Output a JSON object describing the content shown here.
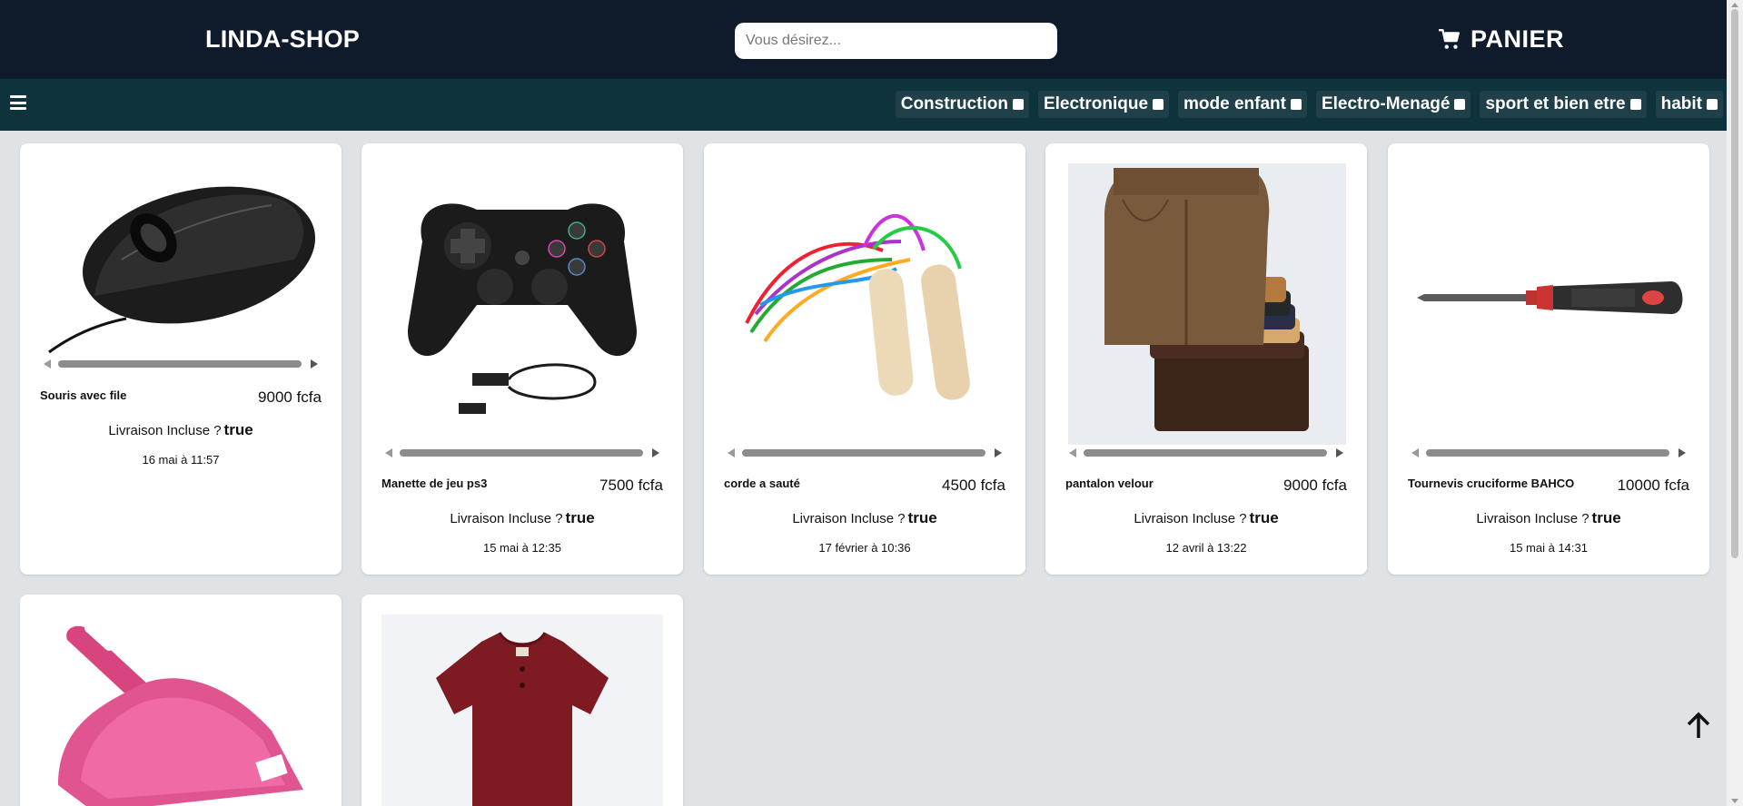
{
  "header": {
    "brand": "LINDA-SHOP",
    "search_placeholder": "Vous désirez...",
    "cart_label": "PANIER"
  },
  "categories": [
    {
      "label": "Construction"
    },
    {
      "label": "Electronique"
    },
    {
      "label": "mode enfant"
    },
    {
      "label": "Electro-Menagé"
    },
    {
      "label": "sport et bien etre"
    },
    {
      "label": "habit"
    }
  ],
  "delivery_label": "Livraison Incluse ?",
  "products": [
    {
      "name": "Souris avec file",
      "price": "9000 fcfa",
      "delivery": "true",
      "date": "16 mai à 11:57",
      "image": "mouse-image"
    },
    {
      "name": "Manette de jeu ps3",
      "price": "7500 fcfa",
      "delivery": "true",
      "date": "15 mai à 12:35",
      "image": "gamepad-image"
    },
    {
      "name": "corde a sauté",
      "price": "4500 fcfa",
      "delivery": "true",
      "date": "17 février à 10:36",
      "image": "jump-rope-image"
    },
    {
      "name": "pantalon velour",
      "price": "9000 fcfa",
      "delivery": "true",
      "date": "12 avril à 13:22",
      "image": "corduroy-pants-image"
    },
    {
      "name": "Tournevis cruciforme BAHCO",
      "price": "10000 fcfa",
      "delivery": "true",
      "date": "15 mai à 14:31",
      "image": "screwdriver-image"
    },
    {
      "image": "dustpan-image"
    },
    {
      "image": "red-shirt-image"
    }
  ],
  "colors": {
    "header_bg": "#0f1a2b",
    "category_bar_bg": "#0e333d",
    "page_bg": "#dfe3e6"
  }
}
